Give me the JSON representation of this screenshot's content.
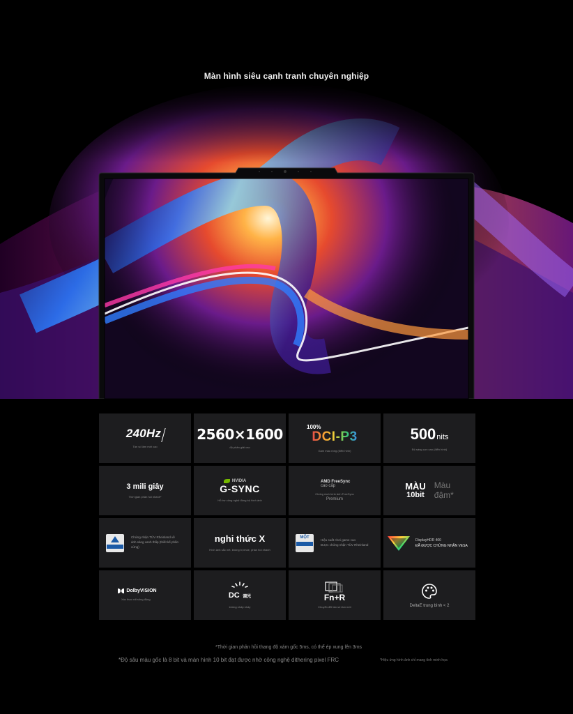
{
  "page": {
    "title": "Màn hình siêu cạnh tranh chuyên nghiệp"
  },
  "tiles": {
    "refresh": {
      "value": "240Hz",
      "sub": "Tần số làm mới cao"
    },
    "resolution": {
      "value": "2560×1600",
      "sub": "độ phân giải cao"
    },
    "gamut": {
      "top": "100%",
      "value": "DCI-P3",
      "sub": "Gam màu rộng (điển hình)"
    },
    "brightness": {
      "value": "500",
      "unit": "nits",
      "sub": "Độ sáng cực cao (điển hình)"
    },
    "response": {
      "value": "3 mili giây",
      "sub": "Thời gian phản hồi nhanh*"
    },
    "gsync": {
      "brand": "NVIDIA",
      "value": "G-SYNC",
      "sub": "Hỗ trợ công nghệ đồng bộ hình ảnh"
    },
    "freesync": {
      "brand": "AMD FreeSync",
      "line2": "cao cấp",
      "sub": "Chống rách hình ảnh FreeSync",
      "premium": "Premium"
    },
    "colordepth": {
      "a1": "MÀU",
      "a2": "10bit",
      "b1": "Màu",
      "b2": "đậm*"
    },
    "tuv": {
      "badge": "TÜVRheinland",
      "l1": "Chứng nhận TÜV Rheinland về",
      "l2": "ánh sáng xanh thấp (thiết kế phần cứng)"
    },
    "xmode": {
      "value": "nghi thức X",
      "sub": "Hình ảnh sắc nét, không bị nhòe, phản hồi nhanh"
    },
    "motion": {
      "badge": "MỘT",
      "l1": "Hiệu suất chơi game cao",
      "l2": "Được chứng nhận TÜV Rheinland"
    },
    "hdr": {
      "l1": "DisplayHDR 400",
      "l2": "ĐÃ ĐƯỢC CHỨNG NHẬN VESA"
    },
    "dolby": {
      "brand": "DolbyVISION",
      "sub": "Xác thực rất sống động"
    },
    "dc": {
      "value": "DC",
      "cn": "调光",
      "sub": "không nhấp nháy"
    },
    "fnr": {
      "value": "Fn+R",
      "sub": "Chuyển đổi tần số làm mới"
    },
    "delta": {
      "value": "DeltaE trung bình < 2"
    }
  },
  "footnotes": {
    "f1": "*Thời gian phản hồi thang độ xám gốc 5ms, có thể ép xung lên 3ms",
    "f2": "*Độ sâu màu gốc là 8 bit và màn hình 10 bit đạt được nhờ công nghệ dithering pixel FRC",
    "f3": "*Hiệu ứng hình ảnh chỉ mang tính minh họa"
  },
  "colors": {
    "background": "#000000",
    "tile": "#1d1d1f",
    "nvidia_green": "#76b900",
    "tuv_blue": "#1b5aa6"
  },
  "icons": [
    "laptop-webcam-icon",
    "nvidia-eye-icon",
    "tuv-badge-icon",
    "vesa-hdr-icon",
    "dolby-icon",
    "dc-dimming-icon",
    "fnr-screens-icon",
    "palette-icon"
  ]
}
